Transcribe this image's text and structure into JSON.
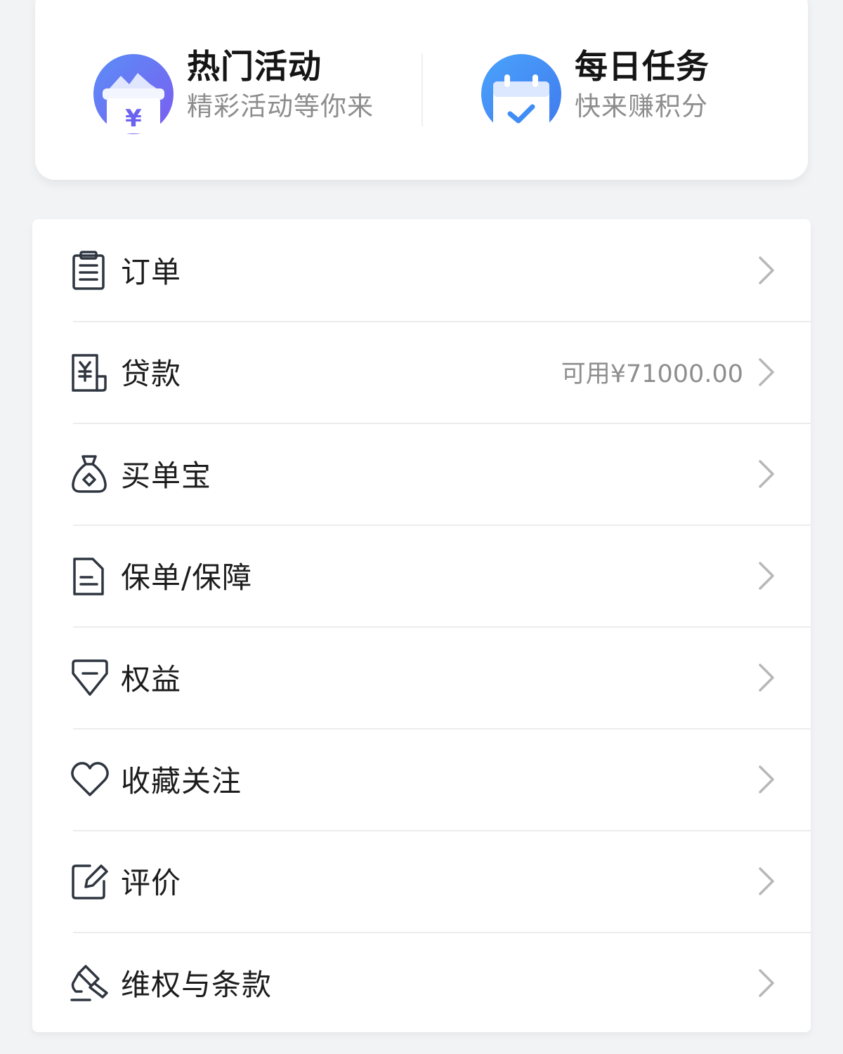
{
  "promos": [
    {
      "title": "热门活动",
      "subtitle": "精彩活动等你来",
      "icon": "activity-gift-icon"
    },
    {
      "title": "每日任务",
      "subtitle": "快来赚积分",
      "icon": "daily-task-calendar-icon"
    }
  ],
  "menu": {
    "items": [
      {
        "label": "订单",
        "value": "",
        "icon": "order-clipboard-icon"
      },
      {
        "label": "贷款",
        "value": "可用¥71000.00",
        "icon": "loan-receipt-icon"
      },
      {
        "label": "买单宝",
        "value": "",
        "icon": "money-bag-icon"
      },
      {
        "label": "保单/保障",
        "value": "",
        "icon": "policy-document-icon"
      },
      {
        "label": "权益",
        "value": "",
        "icon": "benefit-diamond-icon"
      },
      {
        "label": "收藏关注",
        "value": "",
        "icon": "heart-icon"
      },
      {
        "label": "评价",
        "value": "",
        "icon": "edit-review-icon"
      },
      {
        "label": "维权与条款",
        "value": "",
        "icon": "gavel-icon"
      }
    ]
  },
  "colors": {
    "accent_blue": "#4f8bf5",
    "accent_purple": "#6d63f2",
    "icon_stroke": "#2f3640",
    "chevron": "#b7b7b7"
  }
}
